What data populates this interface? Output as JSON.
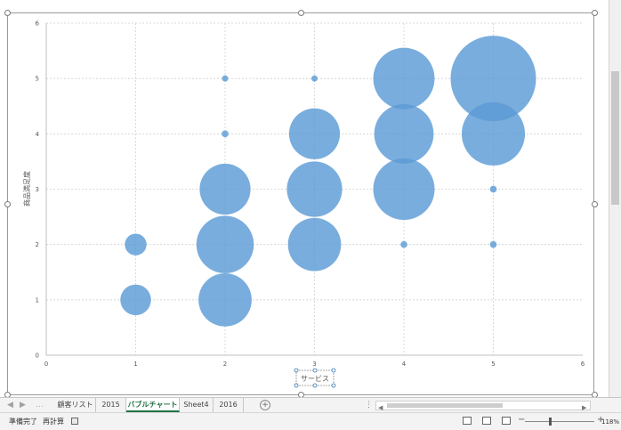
{
  "chart_data": {
    "type": "bubble",
    "title": "",
    "xlabel": "サービス",
    "ylabel": "商品満足度",
    "xlim": [
      0,
      6
    ],
    "ylim": [
      0,
      6
    ],
    "x_ticks": [
      "0",
      "1",
      "2",
      "3",
      "4",
      "5",
      "6"
    ],
    "y_ticks": [
      "0",
      "1",
      "2",
      "3",
      "4",
      "5",
      "6"
    ],
    "grid": true,
    "legend": "none",
    "bubble_color": "#5B9BD5",
    "points": [
      {
        "x": 1,
        "y": 1,
        "size": 4
      },
      {
        "x": 1,
        "y": 2,
        "size": 2
      },
      {
        "x": 2,
        "y": 1,
        "size": 12
      },
      {
        "x": 2,
        "y": 2,
        "size": 14
      },
      {
        "x": 2,
        "y": 3,
        "size": 11
      },
      {
        "x": 2,
        "y": 4,
        "size": 0.2
      },
      {
        "x": 2,
        "y": 5,
        "size": 0.1
      },
      {
        "x": 3,
        "y": 2,
        "size": 12
      },
      {
        "x": 3,
        "y": 3,
        "size": 13
      },
      {
        "x": 3,
        "y": 4,
        "size": 11
      },
      {
        "x": 3,
        "y": 5,
        "size": 0.1
      },
      {
        "x": 4,
        "y": 2,
        "size": 0.2
      },
      {
        "x": 4,
        "y": 3,
        "size": 16
      },
      {
        "x": 4,
        "y": 4,
        "size": 15
      },
      {
        "x": 4,
        "y": 5,
        "size": 16
      },
      {
        "x": 5,
        "y": 2,
        "size": 0.2
      },
      {
        "x": 5,
        "y": 3,
        "size": 0.2
      },
      {
        "x": 5,
        "y": 4,
        "size": 17
      },
      {
        "x": 5,
        "y": 5,
        "size": 31
      }
    ]
  },
  "sheet_tabs": {
    "items": [
      {
        "label": "顧客リスト",
        "active": false
      },
      {
        "label": "2015",
        "active": false
      },
      {
        "label": "バブルチャート",
        "active": true
      },
      {
        "label": "Sheet4",
        "active": false
      },
      {
        "label": "2016",
        "active": false
      }
    ],
    "add_label": "+"
  },
  "statusbar": {
    "ready_label": "準備完了",
    "recalc_label": "再計算",
    "zoom_level": "118%"
  }
}
